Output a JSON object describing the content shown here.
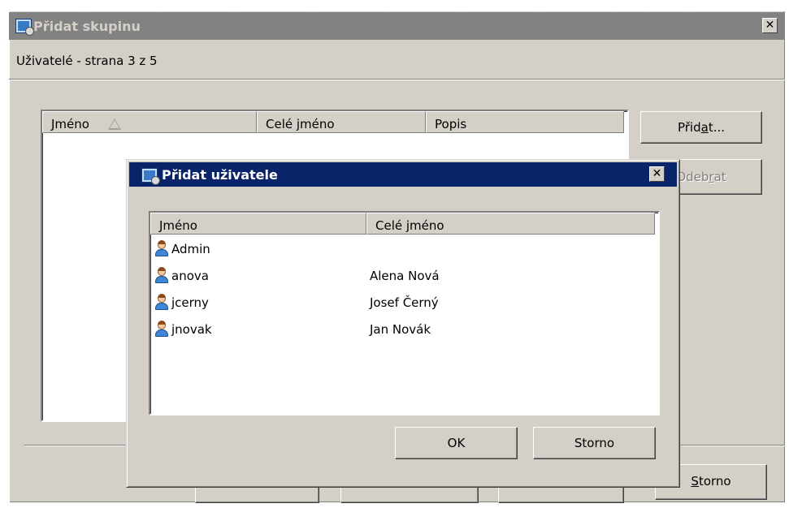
{
  "outer_window": {
    "title": "Přidat skupinu",
    "subtitle": "Uživatelé - strana 3 z 5",
    "columns": [
      "Jméno",
      "Celé jméno",
      "Popis"
    ],
    "add_button": {
      "pre": "Přid",
      "key": "a",
      "post": "t..."
    },
    "remove_button": {
      "pre": "Odeb",
      "key": "r",
      "post": "at"
    },
    "cancel_button": {
      "pre": "",
      "key": "S",
      "post": "torno"
    }
  },
  "dialog": {
    "title": "Přidat uživatele",
    "columns": [
      "Jméno",
      "Celé jméno"
    ],
    "users": [
      {
        "name": "Admin",
        "full_name": ""
      },
      {
        "name": "anova",
        "full_name": "Alena Nová"
      },
      {
        "name": "jcerny",
        "full_name": "Josef Černý"
      },
      {
        "name": "jnovak",
        "full_name": "Jan Novák"
      }
    ],
    "ok_button": "OK",
    "cancel_button": "Storno"
  },
  "icons": {
    "app": "window-gear-icon",
    "user": "user-icon",
    "close": "close-icon",
    "sort": "sort-ascending-icon"
  },
  "colors": {
    "dialog_face": "#d4d0c8",
    "active_titlebar": "#0a246a",
    "inactive_titlebar": "#7f7f7f"
  }
}
